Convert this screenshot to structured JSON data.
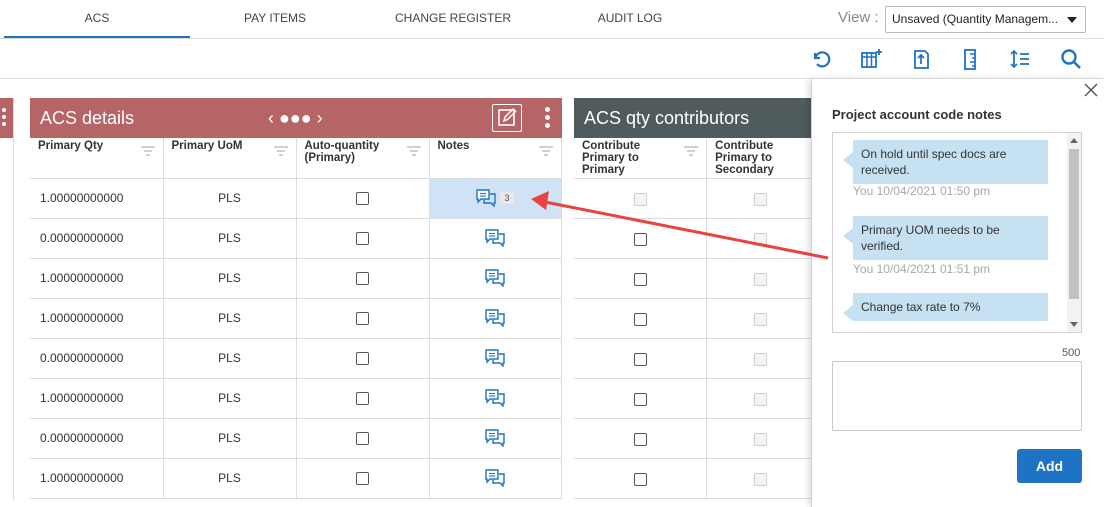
{
  "tabs": [
    {
      "label": "ACS",
      "active": true
    },
    {
      "label": "PAY ITEMS",
      "active": false
    },
    {
      "label": "CHANGE REGISTER",
      "active": false
    },
    {
      "label": "AUDIT LOG",
      "active": false
    }
  ],
  "view": {
    "label": "View :",
    "selected": "Unsaved (Quantity Managem..."
  },
  "toolbar_icons": [
    "refresh-icon",
    "add-column-icon",
    "export-icon",
    "ruler-icon",
    "sort-lines-icon",
    "search-icon"
  ],
  "acs_panel": {
    "title": "ACS details",
    "nav": "‹ ●●● ›",
    "columns": [
      "Primary Qty",
      "Primary UoM",
      "Auto-quantity (Primary)",
      "Notes"
    ],
    "rows": [
      {
        "qty": "1.00000000000",
        "uom": "PLS",
        "notes_count": "3",
        "selected": true
      },
      {
        "qty": "0.00000000000",
        "uom": "PLS",
        "notes_count": "",
        "selected": false
      },
      {
        "qty": "1.00000000000",
        "uom": "PLS",
        "notes_count": "",
        "selected": false
      },
      {
        "qty": "1.00000000000",
        "uom": "PLS",
        "notes_count": "",
        "selected": false
      },
      {
        "qty": "0.00000000000",
        "uom": "PLS",
        "notes_count": "",
        "selected": false
      },
      {
        "qty": "1.00000000000",
        "uom": "PLS",
        "notes_count": "",
        "selected": false
      },
      {
        "qty": "0.00000000000",
        "uom": "PLS",
        "notes_count": "",
        "selected": false
      },
      {
        "qty": "1.00000000000",
        "uom": "PLS",
        "notes_count": "",
        "selected": false
      }
    ]
  },
  "qty_panel": {
    "title": "ACS qty contributors",
    "columns": [
      "Contribute Primary to Primary",
      "Contribute Primary to Secondary"
    ]
  },
  "notes_panel": {
    "title": "Project account code notes",
    "notes": [
      {
        "text": "On hold until spec docs are received.",
        "stamp": "You 10/04/2021 01:50 pm"
      },
      {
        "text": "Primary UOM needs to be verified.",
        "stamp": "You 10/04/2021 01:51 pm"
      },
      {
        "text": "Change tax rate to 7%",
        "stamp": ""
      }
    ],
    "char_limit": "500",
    "input_value": "",
    "add_label": "Add"
  },
  "colors": {
    "accent": "#1f73c4",
    "acs_header": "#b56566",
    "qty_header": "#4f5b5c",
    "annotation_arrow": "#e8443f"
  }
}
